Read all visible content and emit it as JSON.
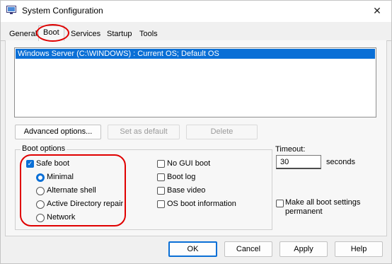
{
  "window": {
    "title": "System Configuration",
    "close_glyph": "✕"
  },
  "tabs": [
    {
      "label": "General"
    },
    {
      "label": "Boot",
      "selected": true
    },
    {
      "label": "Services"
    },
    {
      "label": "Startup"
    },
    {
      "label": "Tools"
    }
  ],
  "os_list": {
    "items": [
      "Windows Server (C:\\WINDOWS) : Current OS; Default OS"
    ],
    "selected_index": 0
  },
  "buttons": {
    "advanced": "Advanced options...",
    "set_default": "Set as default",
    "delete": "Delete"
  },
  "boot_options": {
    "title": "Boot options",
    "safe_boot": {
      "label": "Safe boot",
      "checked": true
    },
    "modes": [
      {
        "label": "Minimal",
        "selected": true
      },
      {
        "label": "Alternate shell",
        "selected": false
      },
      {
        "label": "Active Directory repair",
        "selected": false
      },
      {
        "label": "Network",
        "selected": false
      }
    ],
    "flags": [
      {
        "label": "No GUI boot",
        "checked": false
      },
      {
        "label": "Boot log",
        "checked": false
      },
      {
        "label": "Base video",
        "checked": false
      },
      {
        "label": "OS boot information",
        "checked": false
      }
    ]
  },
  "timeout": {
    "label": "Timeout:",
    "value": "30",
    "unit": "seconds"
  },
  "make_permanent": {
    "label": "Make all boot settings permanent",
    "checked": false
  },
  "footer": {
    "ok": "OK",
    "cancel": "Cancel",
    "apply": "Apply",
    "help": "Help"
  },
  "colors": {
    "accent": "#0a6fd6",
    "annotation": "#e00000"
  }
}
